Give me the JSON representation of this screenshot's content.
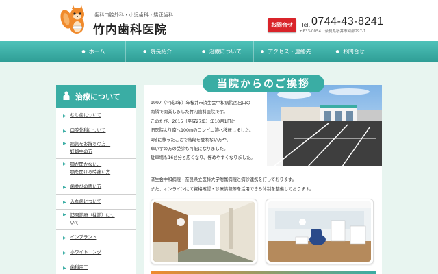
{
  "header": {
    "tagline": "歯科口腔外科・小児歯科・矯正歯科",
    "site_name": "竹内歯科医院",
    "contact_button": "お問合せ",
    "tel_label": "Tel.",
    "tel_number": "0744-43-8241",
    "address": "〒633-0054　奈良県桜井市阿部297-1"
  },
  "nav": [
    {
      "label": "ホーム"
    },
    {
      "label": "院長紹介"
    },
    {
      "label": "治療について"
    },
    {
      "label": "アクセス・連絡先"
    },
    {
      "label": "お問合せ"
    }
  ],
  "sidebar": {
    "title": "治療について",
    "items": [
      {
        "line1": "むし歯について",
        "line2": ""
      },
      {
        "line1": "口腔外科について",
        "line2": ""
      },
      {
        "line1": "病気をお持ちの方、",
        "line2": "妊娠中の方"
      },
      {
        "line1": "顎が開かない、",
        "line2": "顎を開ける時痛い方"
      },
      {
        "line1": "歯並びの悪い方",
        "line2": ""
      },
      {
        "line1": "入れ歯について",
        "line2": ""
      },
      {
        "line1": "訪問診療（往診）につ",
        "line2": "いて"
      },
      {
        "line1": "インプラント",
        "line2": ""
      },
      {
        "line1": "ホワイトニング",
        "line2": ""
      },
      {
        "line1": "歯科用工",
        "line2": ""
      }
    ]
  },
  "main": {
    "title": "当院からのご挨拶",
    "intro": [
      "1997（平成9年）年桜井市済生会中和病院西出口の",
      "南隣で開業しました竹内歯科医院です。",
      "このたび、2015（平成27年）年10月1日に",
      "旧医院より南へ100mのコンビニ跡へ移転しました。",
      "1階に移ったことで階段を登れない方や、",
      "車いすの方の受診も可能になりました。",
      "駐車場も16台分と広くなり、停めやすくなりました。"
    ],
    "notes": [
      "済生会中和病院・奈良県立医科大学附属病院と病診連携を行っております。",
      "また、オンラインにて資格確認・診療情報等を活用できる体制を整備しております。"
    ]
  },
  "colors": {
    "teal": "#3aada4",
    "red": "#d9242a",
    "orange": "#f08a2c"
  }
}
